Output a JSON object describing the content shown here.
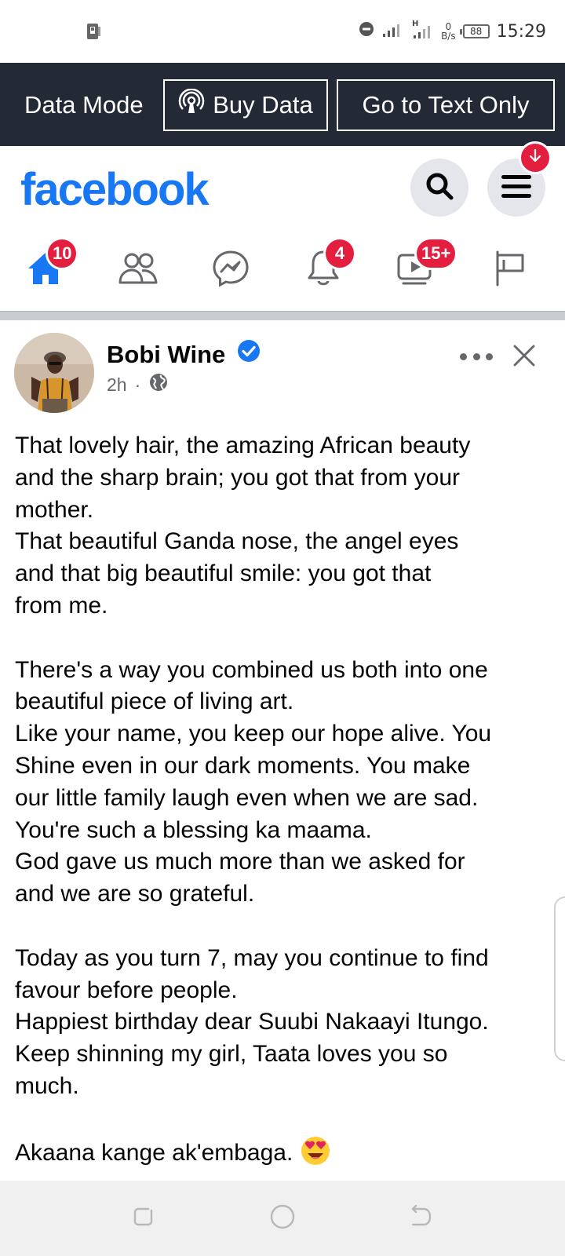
{
  "status_bar": {
    "time": "15:29",
    "network_speed_value": "0",
    "network_speed_unit": "B/s",
    "battery": "88",
    "network_type": "H"
  },
  "data_bar": {
    "mode_label": "Data Mode",
    "buy_data_label": "Buy Data",
    "text_only_label": "Go to Text Only"
  },
  "header": {
    "logo": "facebook",
    "brand_color": "#1877f2"
  },
  "nav": {
    "home_badge": "10",
    "notifications_badge": "4",
    "watch_badge": "15+"
  },
  "post": {
    "author": "Bobi Wine",
    "time_ago": "2h",
    "separator": "·",
    "body": "That lovely hair, the amazing African beauty\nand the sharp brain; you got that from your\nmother.\nThat beautiful Ganda nose, the angel eyes\nand that big beautiful smile: you got that\nfrom me.\n\nThere's a way you combined us both into one\nbeautiful piece of living art.\nLike your name, you keep our hope alive. You\nShine even in our dark moments. You make\nour little family laugh even when we are sad.\nYou're such a blessing ka maama.\nGod gave us much more than we asked for\nand we are so grateful.\n\nToday as you turn 7, may you continue to find\nfavour before people.\nHappiest birthday dear Suubi Nakaayi Itungo.\nKeep shinning my girl, Taata loves you so\nmuch.\n\nAkaana kange ak'embaga. ",
    "emoji": "heart-eyes-emoji"
  },
  "colors": {
    "badge_red": "#e41e3f",
    "data_bar_bg": "#232a36",
    "verified_blue": "#1877f2"
  }
}
